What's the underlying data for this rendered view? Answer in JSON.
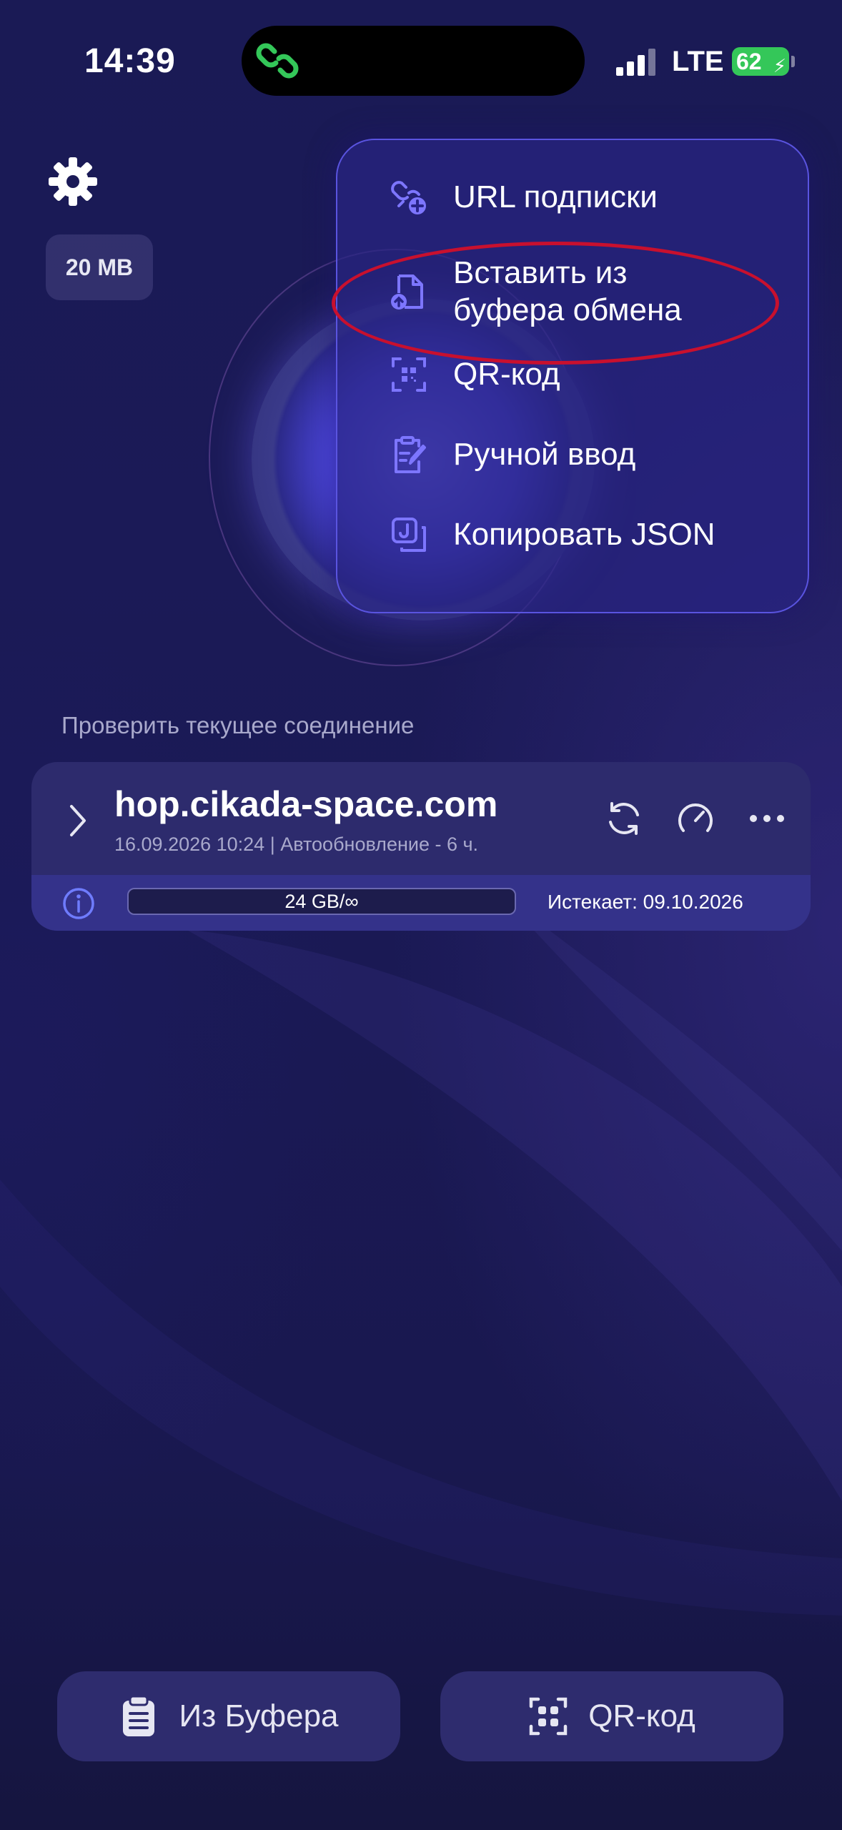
{
  "status_bar": {
    "time": "14:39",
    "network": "LTE",
    "battery": "62",
    "battery_icon": "bolt-icon",
    "signal_icon": "cellular-signal-icon",
    "island_icon": "link-chain-icon",
    "island_icon_color": "#34c759"
  },
  "settings": {
    "icon": "gear-icon"
  },
  "data_chip": {
    "label": "20 MB"
  },
  "menu": {
    "items": [
      {
        "label": "URL подписки",
        "icon": "link-plus-icon"
      },
      {
        "label": "Вставить из\nбуфера обмена",
        "icon": "file-upload-icon",
        "highlighted": true
      },
      {
        "label": "QR-код",
        "icon": "qr-scan-icon"
      },
      {
        "label": "Ручной ввод",
        "icon": "clipboard-edit-icon"
      },
      {
        "label": "Копировать JSON",
        "icon": "json-copy-icon"
      }
    ],
    "accent_color": "#6f68ff",
    "highlight_color": "#c8102e"
  },
  "check_connection": {
    "label": "Проверить текущее соединение"
  },
  "server_card": {
    "name": "hop.cikada-space.com",
    "meta": "16.09.2026 10:24 | Автообновление - 6 ч.",
    "traffic": "24 GB/∞",
    "traffic_fraction": 0,
    "expires": "Истекает: 09.10.2026",
    "actions": [
      "refresh-icon",
      "speedometer-icon",
      "more-icon"
    ],
    "expand_icon": "chevron-right-icon",
    "info_icon": "info-icon"
  },
  "bottom_buttons": {
    "clipboard": {
      "label": "Из Буфера",
      "icon": "clipboard-icon"
    },
    "qr": {
      "label": "QR-код",
      "icon": "qr-scan-icon"
    }
  }
}
